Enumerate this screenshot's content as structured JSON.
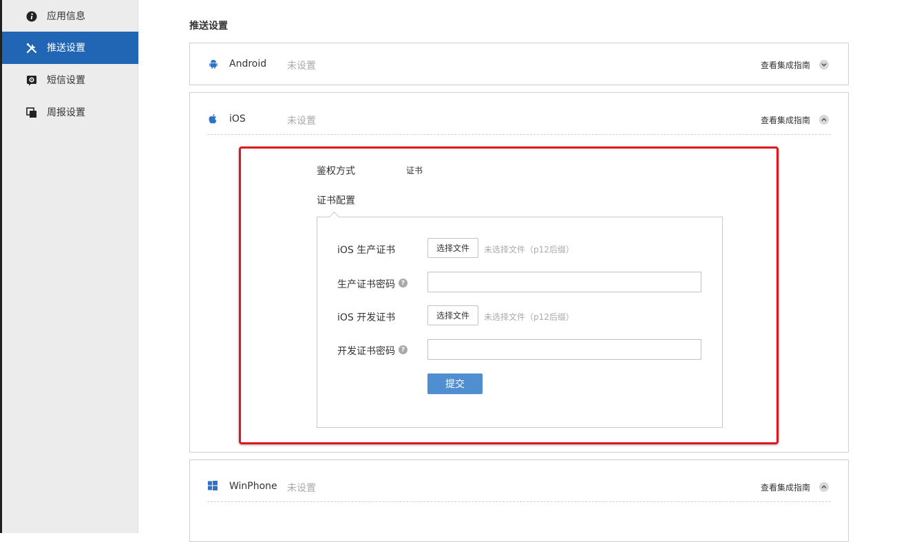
{
  "sidebar": {
    "items": [
      {
        "label": "应用信息",
        "icon": "info-icon",
        "active": false
      },
      {
        "label": "推送设置",
        "icon": "tools-icon",
        "active": true
      },
      {
        "label": "短信设置",
        "icon": "sms-gear-icon",
        "active": false
      },
      {
        "label": "周报设置",
        "icon": "copy-icon",
        "active": false
      }
    ]
  },
  "main": {
    "section_title": "推送设置",
    "guide_label": "查看集成指南",
    "platforms": [
      {
        "name": "Android",
        "status": "未设置",
        "icon": "android-icon",
        "expanded": false
      },
      {
        "name": "iOS",
        "status": "未设置",
        "icon": "apple-icon",
        "expanded": true
      },
      {
        "name": "WinPhone",
        "status": "未设置",
        "icon": "windows-icon",
        "expanded": true
      }
    ],
    "ios_config": {
      "auth_label": "鉴权方式",
      "auth_value": "证书",
      "cert_config_label": "证书配置",
      "prod_cert_label": "iOS 生产证书",
      "prod_pwd_label": "生产证书密码",
      "dev_cert_label": "iOS 开发证书",
      "dev_pwd_label": "开发证书密码",
      "choose_file_label": "选择文件",
      "no_file_hint": "未选择文件（p12后缀）",
      "help_glyph": "?",
      "submit_label": "提交"
    }
  },
  "colors": {
    "accent": "#2166b4",
    "submit": "#4f8fd1",
    "highlight": "#e0141c"
  }
}
